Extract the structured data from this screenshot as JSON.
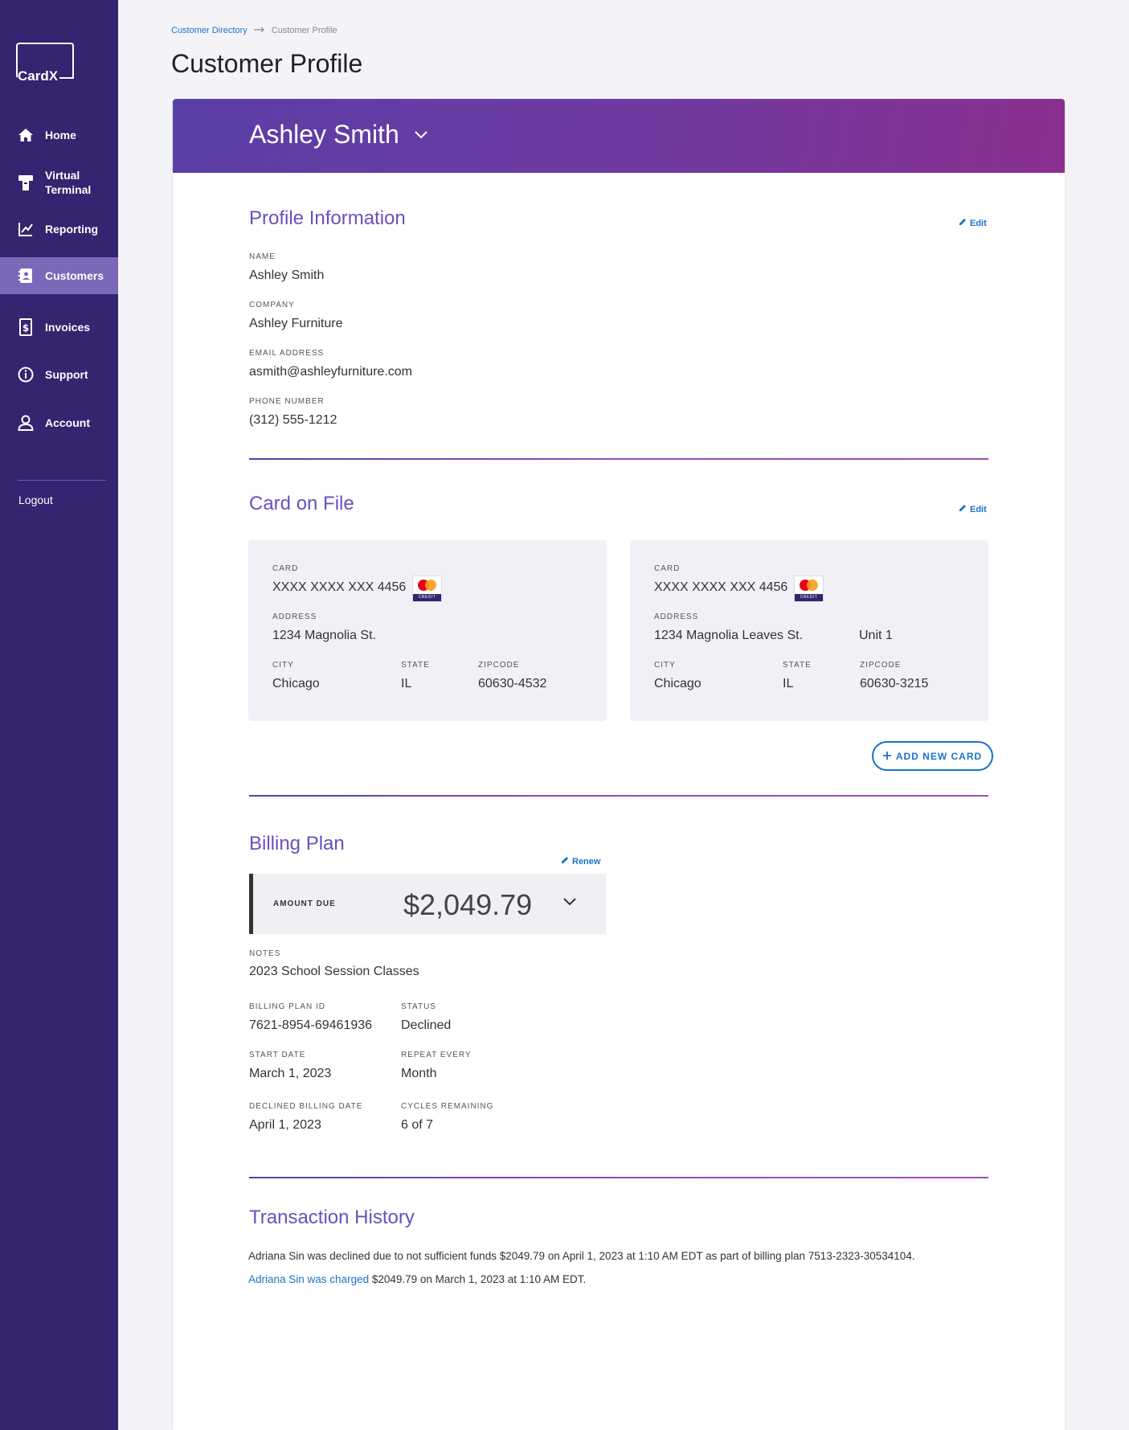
{
  "app": {
    "logo_text": "CardX"
  },
  "sidebar": {
    "items": [
      {
        "label": "Home",
        "icon": "home-icon"
      },
      {
        "label": "Virtual Terminal",
        "icon": "terminal-icon"
      },
      {
        "label": "Reporting",
        "icon": "chart-icon"
      },
      {
        "label": "Customers",
        "icon": "contacts-icon",
        "active": true
      },
      {
        "label": "Invoices",
        "icon": "invoice-icon"
      },
      {
        "label": "Support",
        "icon": "info-icon"
      },
      {
        "label": "Account",
        "icon": "user-icon"
      }
    ],
    "logout_label": "Logout"
  },
  "breadcrumb": {
    "parent": "Customer Directory",
    "current": "Customer Profile"
  },
  "page_title": "Customer Profile",
  "customer": {
    "name": "Ashley Smith"
  },
  "profile_info": {
    "title": "Profile Information",
    "edit_label": "Edit",
    "name_label": "NAME",
    "name_value": "Ashley Smith",
    "company_label": "COMPANY",
    "company_value": "Ashley Furniture",
    "email_label": "EMAIL ADDRESS",
    "email_value": "asmith@ashleyfurniture.com",
    "phone_label": "PHONE NUMBER",
    "phone_value": "(312) 555-1212"
  },
  "card_on_file": {
    "title": "Card on File",
    "edit_label": "Edit",
    "cards": [
      {
        "card_label": "CARD",
        "card_number": "XXXX XXXX XXX 4456",
        "brand_band": "CREDIT",
        "address_label": "ADDRESS",
        "address": "1234 Magnolia St.",
        "unit": "",
        "city_label": "CITY",
        "city": "Chicago",
        "state_label": "STATE",
        "state": "IL",
        "zip_label": "ZIPCODE",
        "zip": "60630-4532"
      },
      {
        "card_label": "CARD",
        "card_number": "XXXX XXXX XXX 4456",
        "brand_band": "CREDIT",
        "address_label": "ADDRESS",
        "address": "1234 Magnolia Leaves St.",
        "unit": "Unit 1",
        "city_label": "CITY",
        "city": "Chicago",
        "state_label": "STATE",
        "state": "IL",
        "zip_label": "ZIPCODE",
        "zip": "60630-3215"
      }
    ],
    "add_card_label": "ADD NEW CARD"
  },
  "billing_plan": {
    "title": "Billing Plan",
    "renew_label": "Renew",
    "amount_due_label": "AMOUNT DUE",
    "amount_due_value": "$2,049.79",
    "notes_label": "NOTES",
    "notes_value": "2023 School Session Classes",
    "plan_id_label": "BILLING PLAN ID",
    "plan_id_value": "7621-8954-69461936",
    "status_label": "STATUS",
    "status_value": "Declined",
    "start_date_label": "START DATE",
    "start_date_value": "March 1, 2023",
    "repeat_label": "REPEAT EVERY",
    "repeat_value": "Month",
    "declined_date_label": "DECLINED BILLING DATE",
    "declined_date_value": "April 1, 2023",
    "cycles_label": "CYCLES REMAINING",
    "cycles_value": "6 of 7"
  },
  "transaction_history": {
    "title": "Transaction History",
    "line1": "Adriana Sin was declined due to not sufficient funds $2049.79 on April 1, 2023 at 1:10 AM EDT as part of billing plan 7513-2323-30534104.",
    "line2_link": "Adriana Sin was charged",
    "line2_rest": " $2049.79 on March 1, 2023 at 1:10 AM EDT."
  },
  "colors": {
    "sidebar_bg": "#35246f",
    "sidebar_active": "#7b68b8",
    "accent_purple": "#6a4fc0",
    "link_blue": "#1a73c9"
  }
}
